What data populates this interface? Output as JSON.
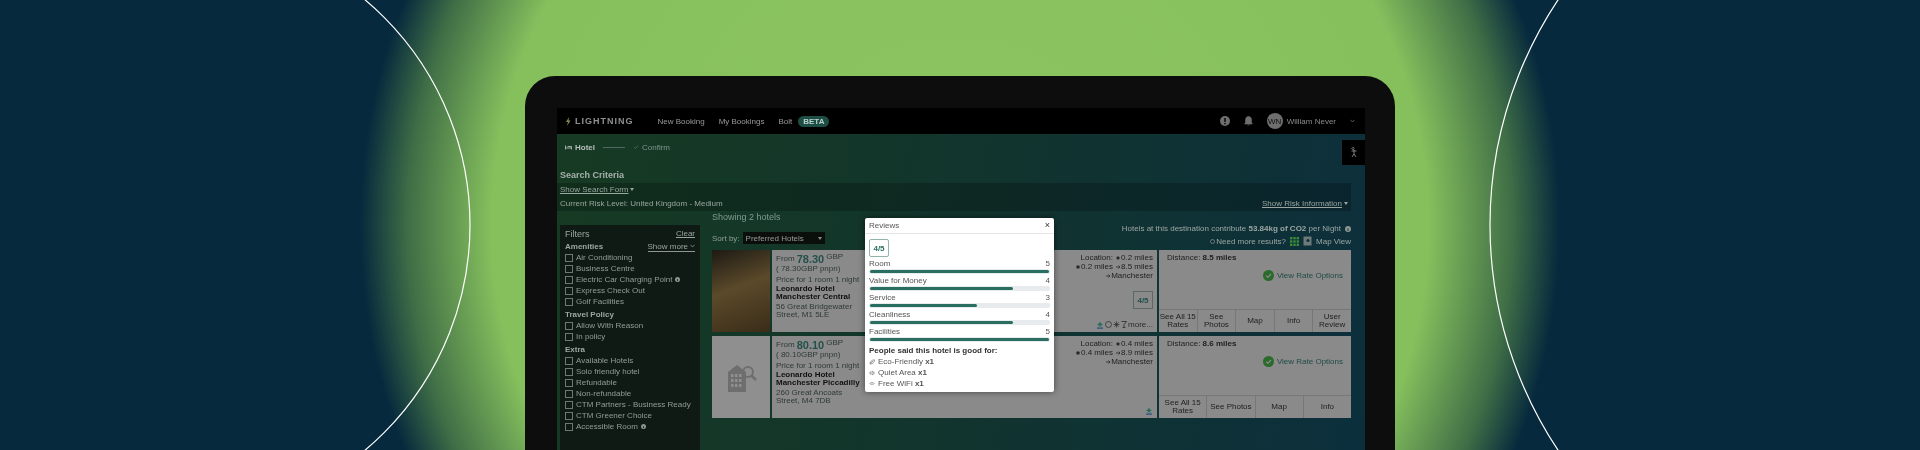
{
  "nav": {
    "brand": "LIGHTNING",
    "links": [
      "New Booking",
      "My Bookings",
      "Bolt"
    ],
    "badge": "BETA",
    "user_initials": "WN",
    "user_name": "William Never"
  },
  "steps": [
    {
      "label": "Hotel",
      "selected": true
    },
    {
      "label": "Confirm",
      "selected": false
    }
  ],
  "search": {
    "title": "Search Criteria",
    "toggle": "Show Search Form",
    "risk": "Current Risk Level: United Kingdom - Medium",
    "risk_link": "Show Risk Information"
  },
  "results": {
    "heading": "Showing 2 hotels",
    "sort_label": "Sort by:",
    "sort_value": "Preferred Hotels",
    "co2": "Hotels at this destination contribute **53.84kg of CO2** per Night",
    "more": "Need more results?",
    "map": "Map View"
  },
  "filters": {
    "title": "Filters",
    "clear": "Clear",
    "groups": [
      {
        "title": "Amenities",
        "more": "Show more",
        "items": [
          {
            "label": "Air Conditioning",
            "checked": false,
            "info": false
          },
          {
            "label": "Business Centre",
            "checked": false,
            "info": false
          },
          {
            "label": "Electric Car Charging Point",
            "checked": false,
            "info": true
          },
          {
            "label": "Express Check Out",
            "checked": false,
            "info": false
          },
          {
            "label": "Golf Facilities",
            "checked": false,
            "info": false
          }
        ]
      },
      {
        "title": "Travel Policy",
        "items": [
          {
            "label": "Allow With Reason",
            "checked": false,
            "info": false
          },
          {
            "label": "In policy",
            "checked": false,
            "info": false
          }
        ]
      },
      {
        "title": "Extra",
        "items": [
          {
            "label": "Available Hotels",
            "checked": false,
            "info": false
          },
          {
            "label": "Solo friendly hotel",
            "checked": false,
            "info": false
          },
          {
            "label": "Refundable",
            "checked": false,
            "info": false
          },
          {
            "label": "Non-refundable",
            "checked": false,
            "info": false
          },
          {
            "label": "CTM Partners - Business Ready",
            "checked": false,
            "info": false
          },
          {
            "label": "CTM Greener Choice",
            "checked": false,
            "info": false
          },
          {
            "label": "Accessible Room",
            "checked": false,
            "info": true
          }
        ]
      }
    ]
  },
  "hotels": [
    {
      "kind": "photo",
      "from": "From",
      "price": "78.30",
      "currency": "GBP",
      "per_night": "( 78.30GBP pnpn)",
      "price_note": "Price for 1 room 1 night",
      "name": "Leonardo Hotel Manchester Central",
      "address": "56 Great Bridgewater Street, M1 5LE",
      "location_label": "Location:",
      "locations": [
        {
          "kind": "train",
          "text": "0.2 miles"
        },
        {
          "kind": "bus",
          "text": "0.2 miles"
        },
        {
          "kind": "plane",
          "text": "8.5 miles"
        },
        {
          "kind": "plane",
          "text": "Manchester"
        }
      ],
      "rating": "4/5",
      "amenities": [
        {
          "kind": "logo"
        },
        {
          "kind": "badge"
        },
        {
          "kind": "snow"
        },
        {
          "kind": "bar"
        }
      ],
      "more": "more...",
      "distance": "Distance: **8.5 miles**",
      "rates": "View Rate Options",
      "tabs": [
        "See All 15 Rates",
        "See Photos",
        "Map",
        "Info",
        "User Review"
      ]
    },
    {
      "kind": "placeholder",
      "from": "From",
      "price": "80.10",
      "currency": "GBP",
      "per_night": "( 80.10GBP pnpn)",
      "price_note": "Price for 1 room 1 night",
      "name": "Leonardo Hotel Manchester Piccadilly",
      "address": "260 Great Ancoats Street, M4 7DB",
      "location_label": "Location:",
      "locations": [
        {
          "kind": "train",
          "text": "0.4 miles"
        },
        {
          "kind": "bus",
          "text": "0.4 miles"
        },
        {
          "kind": "plane",
          "text": "8.9 miles"
        },
        {
          "kind": "plane",
          "text": "Manchester"
        }
      ],
      "amenities": [
        {
          "kind": "logo"
        }
      ],
      "distance": "Distance: **8.6 miles**",
      "rates": "View Rate Options",
      "tabs": [
        "See All 15 Rates",
        "See Photos",
        "Map",
        "Info"
      ]
    }
  ],
  "modal": {
    "title": "Reviews",
    "close": "×",
    "score": "4/5",
    "categories": [
      {
        "label": "Room",
        "value": "5",
        "level": 1
      },
      {
        "label": "Value for Money",
        "value": "4",
        "level": 0.8
      },
      {
        "label": "Service",
        "value": "3",
        "level": 0.6
      },
      {
        "label": "Cleanliness",
        "value": "4",
        "level": 0.8
      },
      {
        "label": "Facilities",
        "value": "5",
        "level": 1
      }
    ],
    "good_for_title": "People said this hotel is good for:",
    "good_for": [
      {
        "kind": "eco",
        "text": "Eco-Friendly **x1**"
      },
      {
        "kind": "quiet",
        "text": "Quiet Area **x1**"
      },
      {
        "kind": "wifi",
        "text": "Free WiFi **x1**"
      }
    ]
  }
}
